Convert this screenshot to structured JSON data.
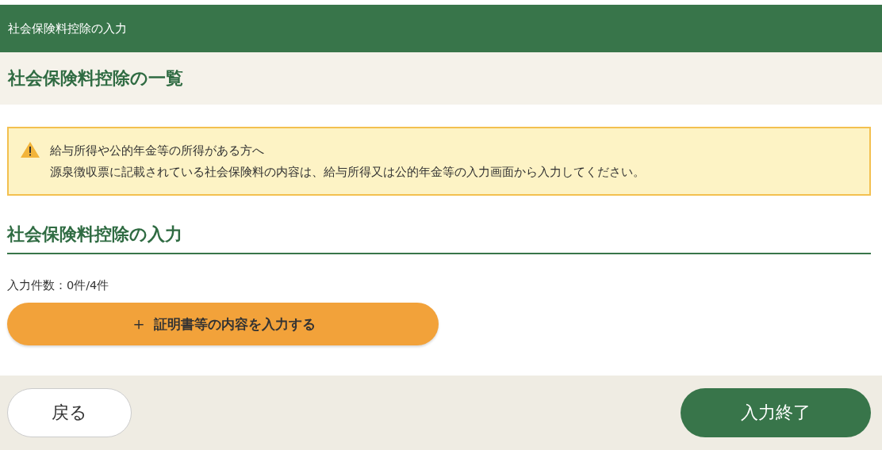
{
  "header": {
    "title": "社会保険料控除の入力"
  },
  "page_title": "社会保険料控除の一覧",
  "notice": {
    "lines": [
      "給与所得や公的年金等の所得がある方へ",
      "源泉徴収票に記載されている社会保険料の内容は、給与所得又は公的年金等の入力画面から入力してください。"
    ]
  },
  "section_title": "社会保険料控除の入力",
  "count_label": "入力件数：0件/4件",
  "add_button": {
    "icon": "＋",
    "label": "証明書等の内容を入力する"
  },
  "footer": {
    "back_button": "戻る",
    "finish_button": "入力終了"
  }
}
